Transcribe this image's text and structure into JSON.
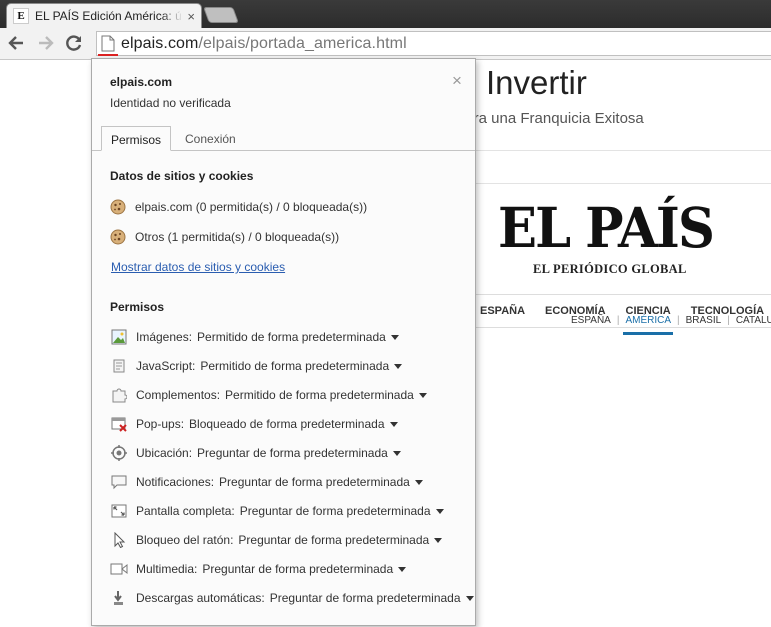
{
  "browser": {
    "tab_title": "EL PAÍS Edición América: ú",
    "tab_favicon": "E",
    "url_domain": "elpais.com",
    "url_path": "/elpais/portada_america.html",
    "icons": [
      "back-icon",
      "forward-icon",
      "reload-icon",
      "page-icon"
    ]
  },
  "page": {
    "ad_title": "Invertir",
    "ad_subtitle": "iera una Franquicia Exitosa",
    "editions": [
      "ESPAÑA",
      "AMÉRICA",
      "BRASIL",
      "CATALUÑA"
    ],
    "active_edition": "AMÉRICA",
    "logo_text": "EL PAÍS",
    "tagline": "EL PERIÓDICO GLOBAL",
    "sections": [
      "ESPAÑA",
      "ECONOMÍA",
      "CIENCIA",
      "TECNOLOGÍA"
    ]
  },
  "popup": {
    "domain": "elpais.com",
    "identity": "Identidad no verificada",
    "close_glyph": "×",
    "tabs": [
      "Permisos",
      "Conexión"
    ],
    "cookies_heading": "Datos de sitios y cookies",
    "cookies": [
      "elpais.com (0 permitida(s) / 0 bloqueada(s))",
      "Otros (1 permitida(s) / 0 bloqueada(s))"
    ],
    "cookies_link": "Mostrar datos de sitios y cookies",
    "permissions_heading": "Permisos",
    "permissions": [
      {
        "label": "Imágenes:",
        "value": "Permitido de forma predeterminada",
        "icon": "image-icon"
      },
      {
        "label": "JavaScript:",
        "value": "Permitido de forma predeterminada",
        "icon": "javascript-icon"
      },
      {
        "label": "Complementos:",
        "value": "Permitido de forma predeterminada",
        "icon": "plugin-icon"
      },
      {
        "label": "Pop-ups:",
        "value": "Bloqueado de forma predeterminada",
        "icon": "popup-blocked-icon"
      },
      {
        "label": "Ubicación:",
        "value": "Preguntar de forma predeterminada",
        "icon": "location-icon"
      },
      {
        "label": "Notificaciones:",
        "value": "Preguntar de forma predeterminada",
        "icon": "notification-icon"
      },
      {
        "label": "Pantalla completa:",
        "value": "Preguntar de forma predeterminada",
        "icon": "fullscreen-icon"
      },
      {
        "label": "Bloqueo del ratón:",
        "value": "Preguntar de forma predeterminada",
        "icon": "mouse-lock-icon"
      },
      {
        "label": "Multimedia:",
        "value": "Preguntar de forma predeterminada",
        "icon": "media-icon"
      },
      {
        "label": "Descargas automáticas:",
        "value": "Preguntar de forma predeterminada",
        "icon": "download-icon"
      }
    ]
  },
  "colors": {
    "link": "#2a5db0",
    "active_edition": "#1a6fa8",
    "blocked_red": "#cc2222"
  }
}
